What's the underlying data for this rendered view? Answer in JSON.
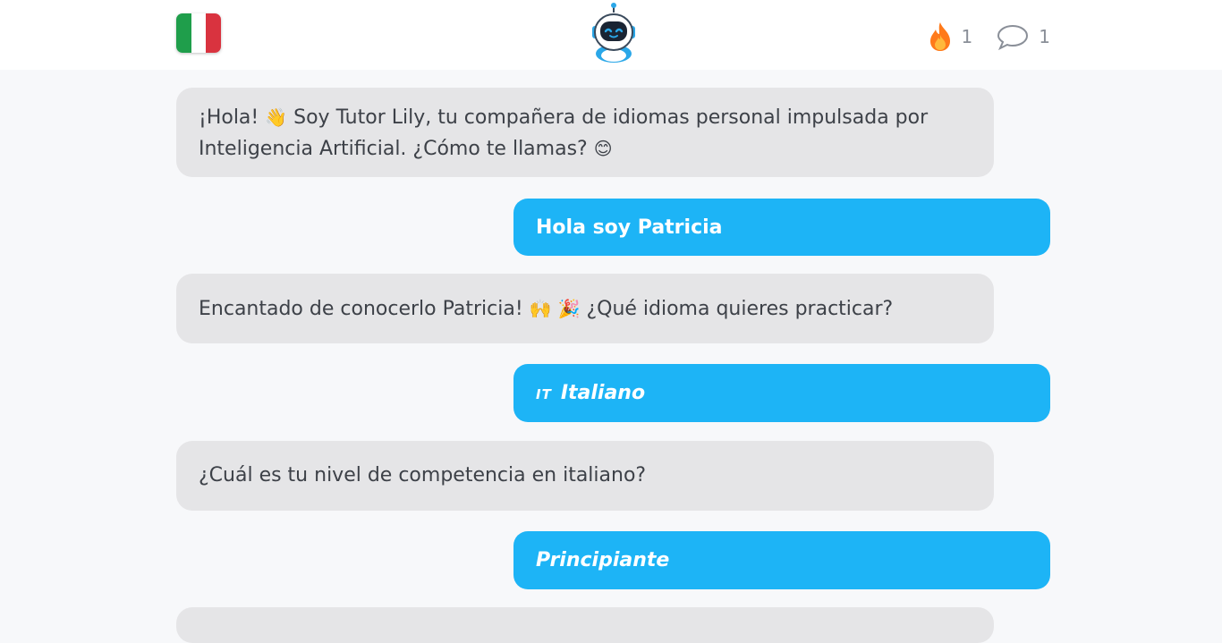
{
  "header": {
    "flag_colors": [
      "#1f9e4b",
      "#ffffff",
      "#d9333f"
    ],
    "streak_icon": "fire-icon",
    "streak_count": "1",
    "messages_icon": "speech-bubble-icon",
    "messages_count": "1"
  },
  "messages": [
    {
      "role": "bot",
      "text_part1": "¡Hola! ",
      "emoji1": "👋",
      "text_part2": " Soy Tutor Lily, tu compañera de idiomas personal impulsada por Inteligencia Artificial. ¿Cómo te llamas? ",
      "emoji2": "😊"
    },
    {
      "role": "user",
      "text": "Hola soy Patricia"
    },
    {
      "role": "bot",
      "text_part1": "Encantado de conocerlo Patricia! ",
      "emoji1": "🙌",
      "emoji2": "🎉",
      "text_part2": " ¿Qué idioma quieres practicar?"
    },
    {
      "role": "user",
      "code": "IT",
      "text": "Italiano"
    },
    {
      "role": "bot",
      "text": "¿Cuál es tu nivel de competencia en italiano?"
    },
    {
      "role": "user",
      "text": "Principiante"
    }
  ],
  "colors": {
    "accent": "#1db4f6",
    "bot_bubble": "#e5e5e7",
    "page_bg": "#f7f8fa"
  }
}
